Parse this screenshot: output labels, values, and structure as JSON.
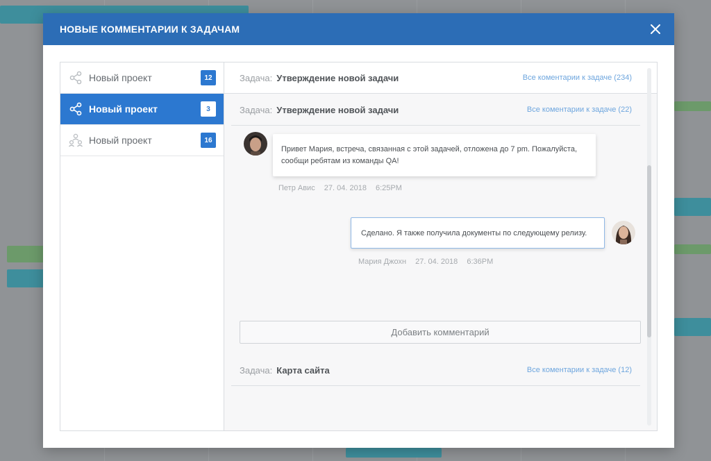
{
  "modal": {
    "title": "НОВЫЕ КОММЕНТАРИИ К ЗАДАЧАМ"
  },
  "sidebar": {
    "items": [
      {
        "label": "Новый проект",
        "badge": "12",
        "icon": "share-icon",
        "active": false
      },
      {
        "label": "Новый проект",
        "badge": "3",
        "icon": "share-icon",
        "active": true
      },
      {
        "label": "Новый проект",
        "badge": "16",
        "icon": "team-icon",
        "active": false
      }
    ]
  },
  "tasks": [
    {
      "prefix": "Задача:",
      "name": "Утверждение новой задачи",
      "link": "Все коментарии к задаче (234)"
    },
    {
      "prefix": "Задача:",
      "name": "Утверждение новой задачи",
      "link": "Все коментарии к задаче (22)"
    },
    {
      "prefix": "Задача:",
      "name": "Карта сайта",
      "link": "Все коментарии к задаче (12)"
    }
  ],
  "comments": [
    {
      "text_line1": "Привет Мария, встреча, связанная с этой задачей, отложена до 7 pm. Пожалуйста,",
      "text_line2": "сообщи ребятам  из команды QA!",
      "author": "Петр Авис",
      "date": "27. 04. 2018",
      "time": "6:25PM"
    },
    {
      "text": "Сделано. Я также получила документы по следующему релизу.",
      "author": "Мария Джохн",
      "date": "27. 04. 2018",
      "time": "6:36PM"
    }
  ],
  "add_comment_label": "Добавить комментарий",
  "colors": {
    "header": "#2c6db6",
    "accent": "#2c78d0",
    "link": "#6ea6de"
  }
}
